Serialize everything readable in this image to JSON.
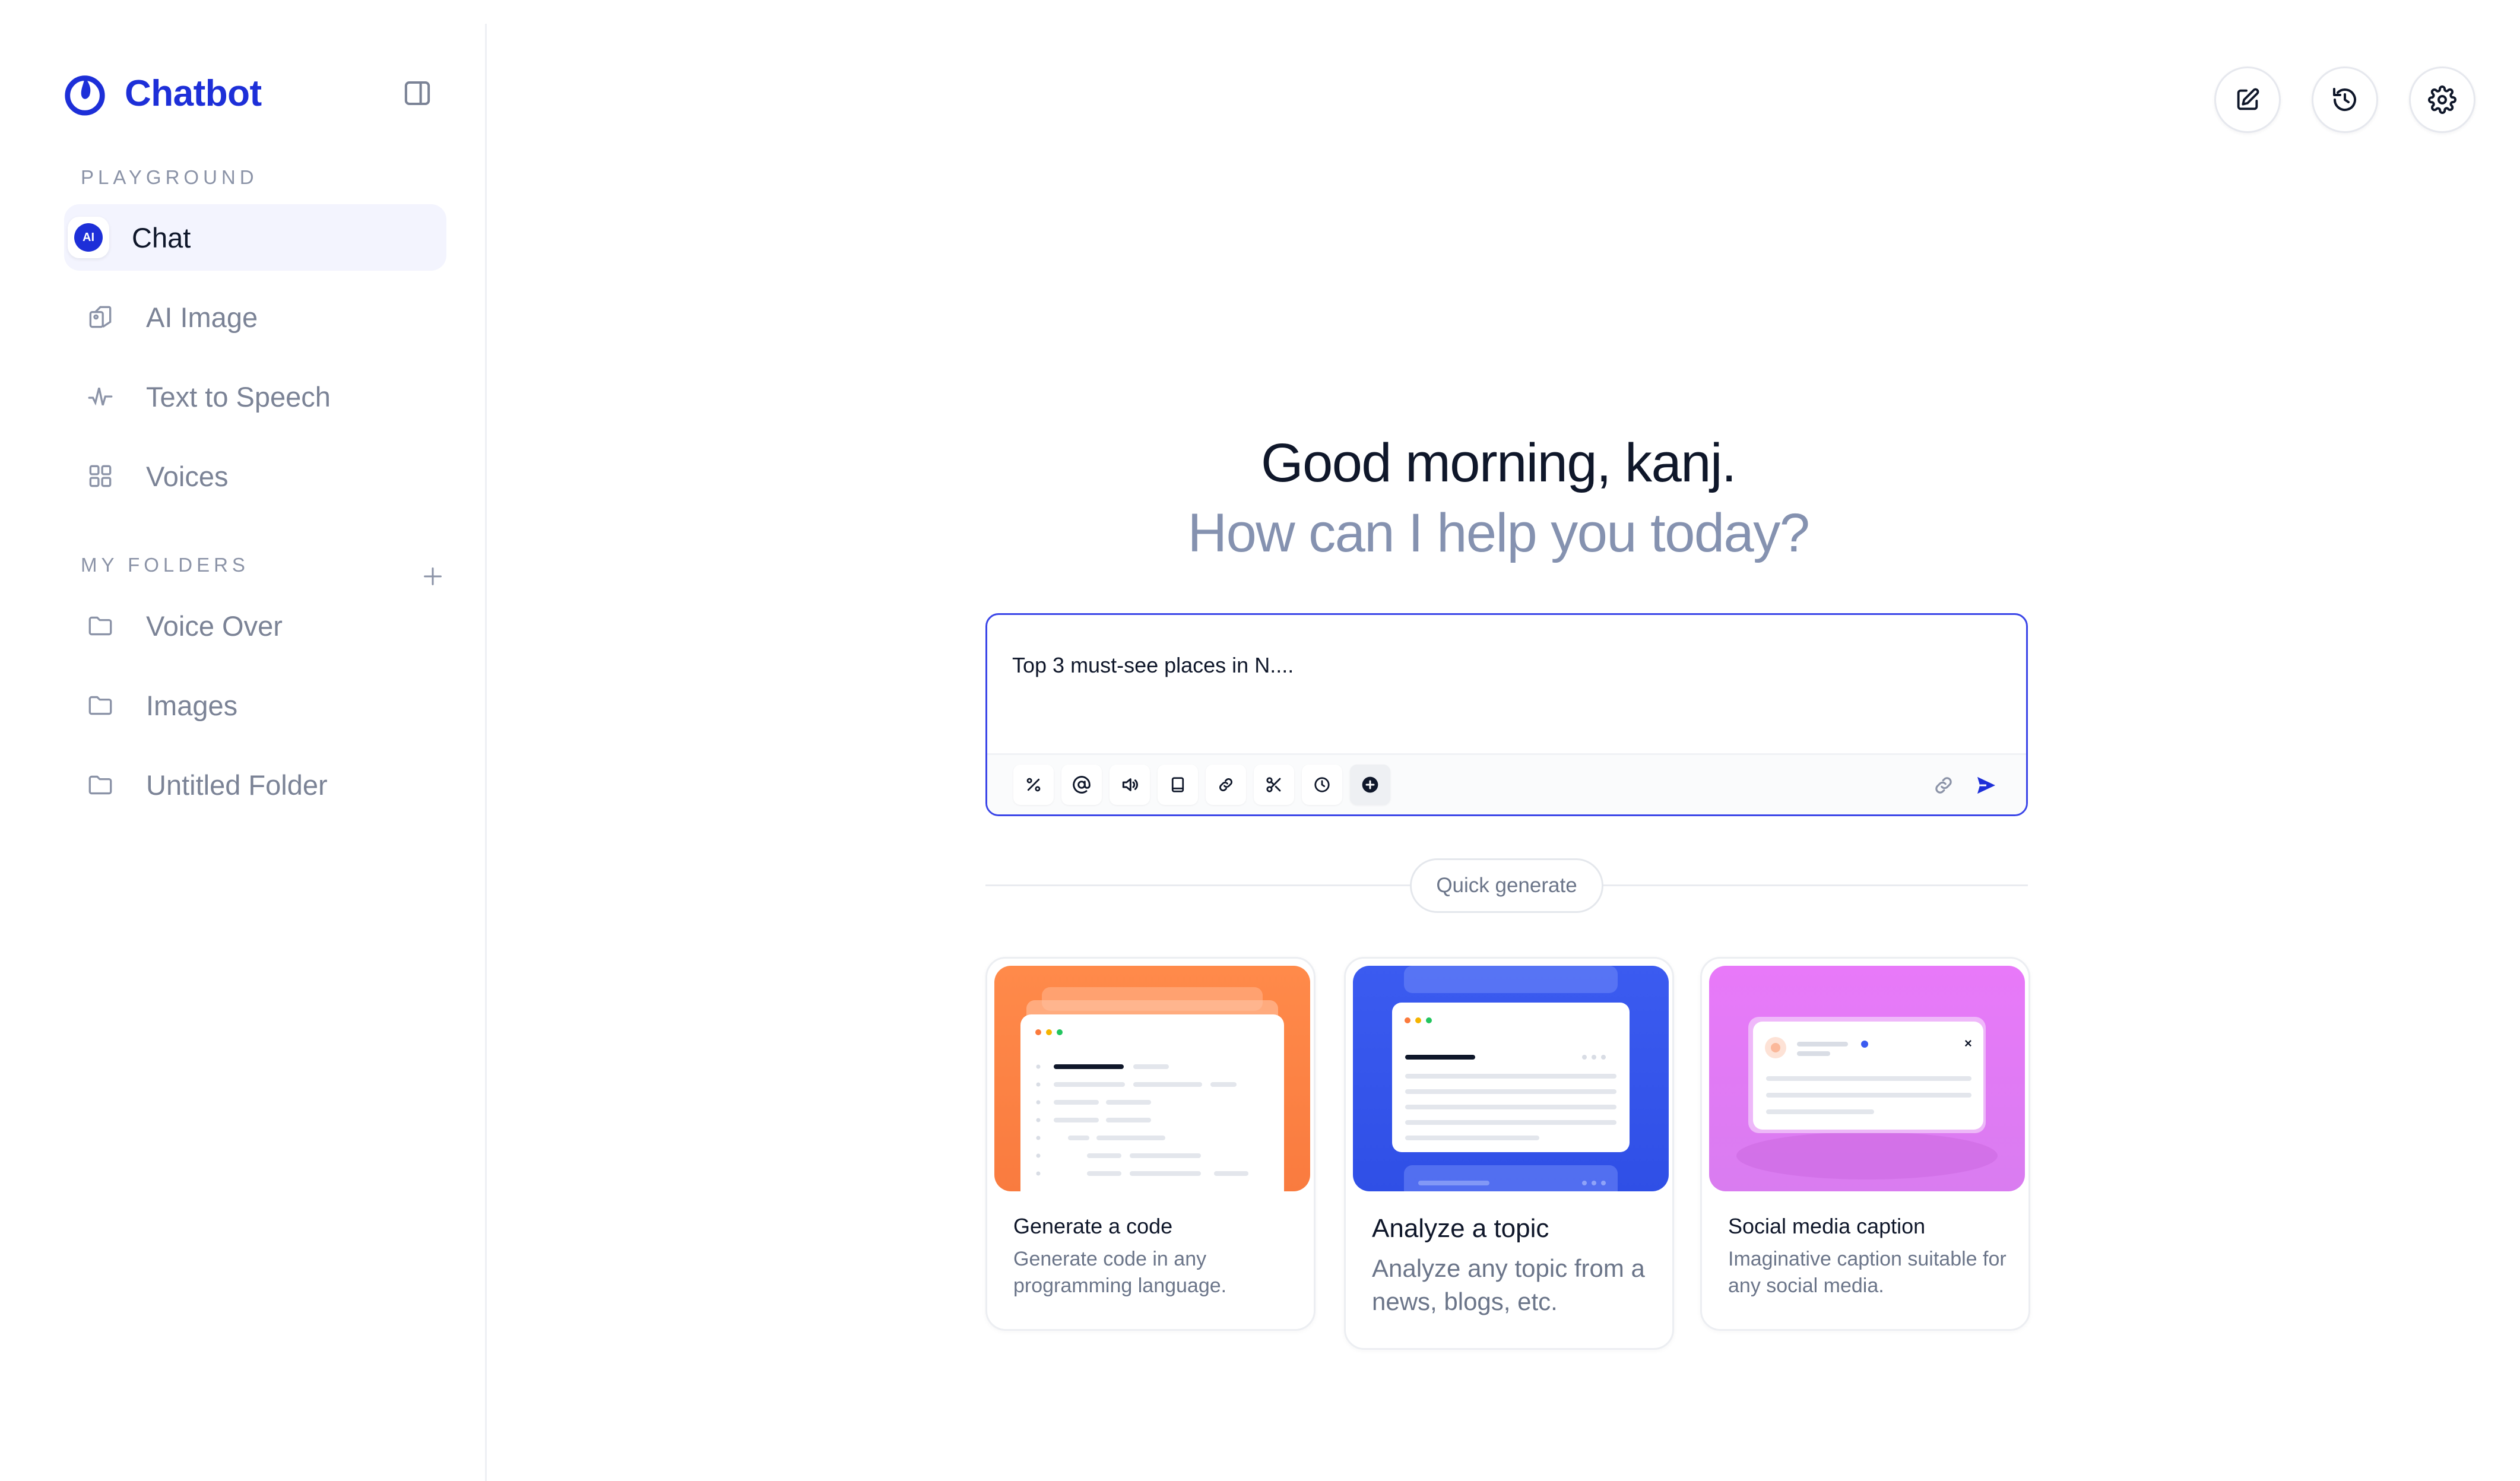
{
  "app": {
    "name": "Chatbot"
  },
  "sidebar": {
    "playground_label": "PLAYGROUND",
    "items": [
      {
        "label": "Chat",
        "icon": "ai-badge-icon",
        "active": true
      },
      {
        "label": "AI Image",
        "icon": "image-icon"
      },
      {
        "label": "Text to Speech",
        "icon": "waveform-icon"
      },
      {
        "label": "Voices",
        "icon": "grid-icon"
      }
    ],
    "folders_label": "MY FOLDERS",
    "folders": [
      {
        "label": "Voice Over",
        "icon": "folder-icon"
      },
      {
        "label": "Images",
        "icon": "folder-icon"
      },
      {
        "label": "Untitled Folder",
        "icon": "folder-icon"
      }
    ],
    "ai_badge_text": "AI"
  },
  "header": {
    "actions": [
      "edit-icon",
      "history-icon",
      "settings-icon"
    ]
  },
  "main": {
    "greeting": "Good morning, kanj.",
    "subtitle": "How can I help you today?",
    "prompt": {
      "value": "Top 3 must-see places in N....",
      "tools": [
        "percent-icon",
        "at-icon",
        "speaker-icon",
        "book-icon",
        "link-icon",
        "scissors-icon",
        "clock-icon",
        "plus-circle-icon"
      ]
    },
    "quick_generate_label": "Quick generate",
    "cards": [
      {
        "title": "Generate a code",
        "description": "Generate code in any programming language.",
        "accent": "#fb7a3c"
      },
      {
        "title": "Analyze a topic",
        "description": "Analyze any topic from a news, blogs, etc.",
        "accent": "#3b5bf0"
      },
      {
        "title": "Social media caption",
        "description": "Imaginative caption suitable for any social media.",
        "accent": "#e77bf2"
      }
    ]
  },
  "colors": {
    "brand": "#1d2fd8",
    "muted_text": "#7b8396",
    "subtitle": "#8592b0",
    "prompt_border": "#3b46e8"
  }
}
